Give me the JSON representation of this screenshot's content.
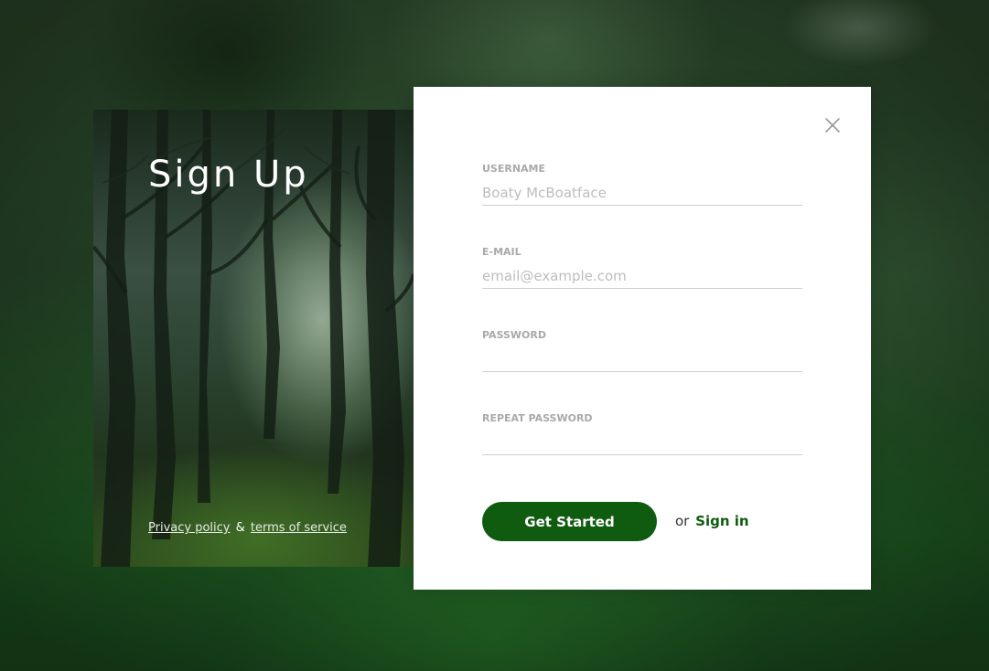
{
  "colors": {
    "accent": "#0f5b0f",
    "label": "#a9a9a9",
    "placeholder": "#bdbdbd",
    "panel_background": "#ffffff"
  },
  "hero": {
    "title": "Sign Up",
    "privacy_link": "Privacy policy",
    "ampersand": "&",
    "terms_link": "terms of service"
  },
  "form": {
    "close_icon": "close-icon",
    "username": {
      "label": "USERNAME",
      "placeholder": "Boaty McBoatface",
      "value": ""
    },
    "email": {
      "label": "E-MAIL",
      "placeholder": "email@example.com",
      "value": ""
    },
    "password": {
      "label": "PASSWORD",
      "placeholder": "",
      "value": ""
    },
    "repeat_password": {
      "label": "REPEAT PASSWORD",
      "placeholder": "",
      "value": ""
    },
    "submit_label": "Get Started",
    "alt_prefix": "or",
    "signin_link": "Sign in"
  }
}
